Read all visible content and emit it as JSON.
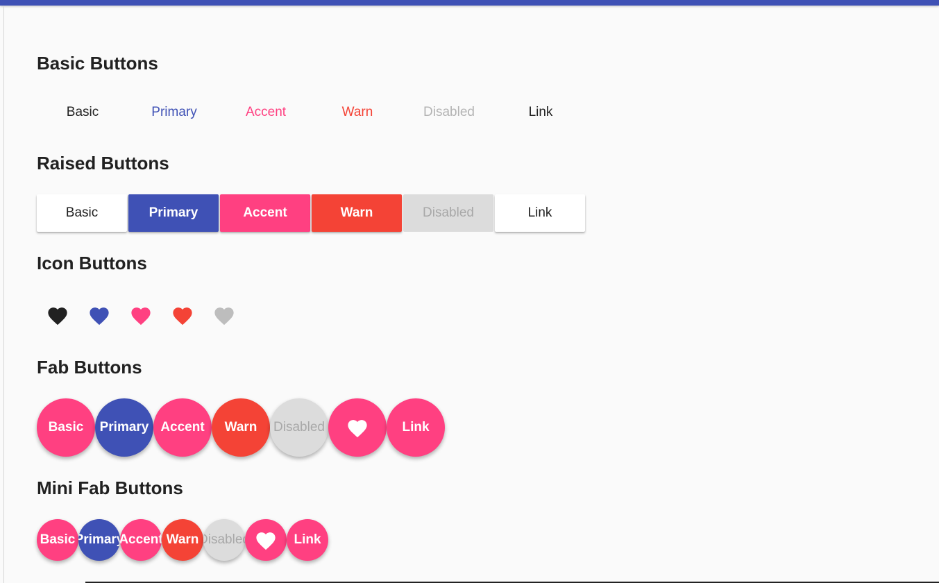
{
  "colors": {
    "primary": "#3f51b5",
    "accent": "#ff4081",
    "warn": "#f44336",
    "disabled_bg": "#dcdcdc",
    "disabled_text": "#a8a8a8",
    "text": "#212121",
    "white": "#ffffff"
  },
  "basic_section": {
    "title": "Basic Buttons",
    "buttons": [
      "Basic",
      "Primary",
      "Accent",
      "Warn",
      "Disabled",
      "Link"
    ]
  },
  "raised_section": {
    "title": "Raised Buttons",
    "buttons": [
      "Basic",
      "Primary",
      "Accent",
      "Warn",
      "Disabled",
      "Link"
    ]
  },
  "icon_section": {
    "title": "Icon Buttons",
    "icons": [
      "heart-icon",
      "heart-icon",
      "heart-icon",
      "heart-icon",
      "heart-icon"
    ]
  },
  "fab_section": {
    "title": "Fab Buttons",
    "buttons": [
      "Basic",
      "Primary",
      "Accent",
      "Warn",
      "Disabled",
      "heart-icon",
      "Link"
    ]
  },
  "mini_fab_section": {
    "title": "Mini Fab Buttons",
    "buttons": [
      "Basic",
      "Primary",
      "Accent",
      "Warn",
      "Disabled",
      "heart-icon",
      "Link"
    ]
  }
}
